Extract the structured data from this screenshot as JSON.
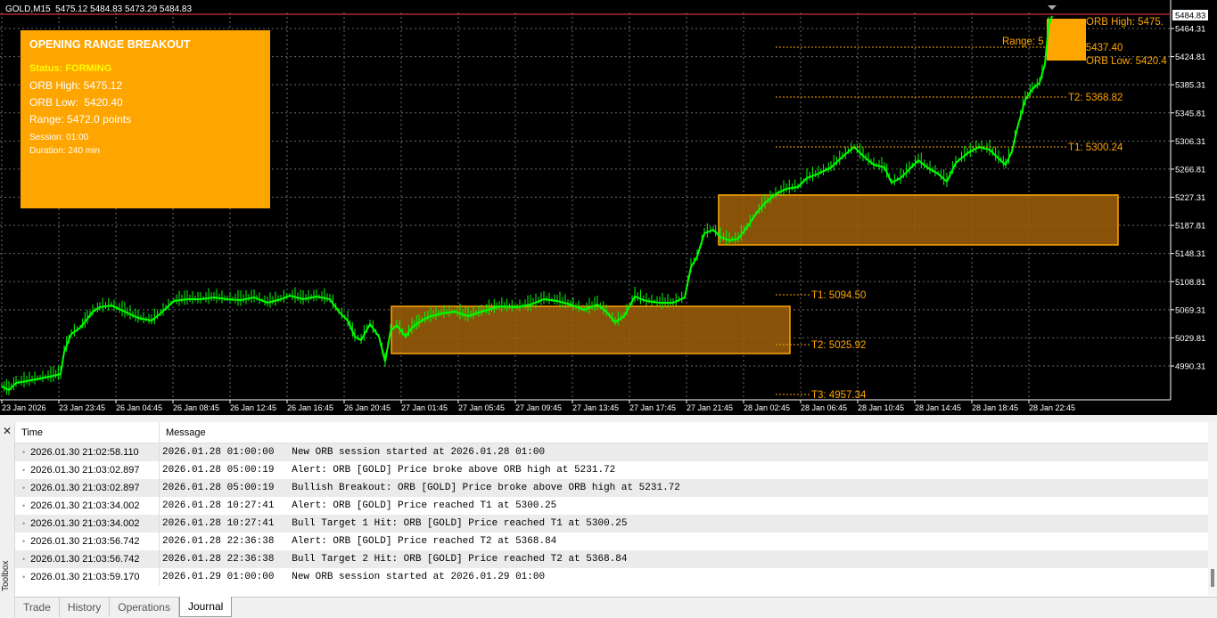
{
  "chart": {
    "symbol_line": "GOLD,M15  5475.12 5484.83 5473.29 5484.83",
    "current_price": "5484.83",
    "price_axis": [
      "5464.31",
      "5424.81",
      "5385.31",
      "5345.81",
      "5306.31",
      "5266.81",
      "5227.31",
      "5187.81",
      "5148.31",
      "5108.81",
      "5069.31",
      "5029.81",
      "4990.31"
    ],
    "time_axis": [
      "23 Jan 2026",
      "23 Jan 23:45",
      "26 Jan 04:45",
      "26 Jan 08:45",
      "26 Jan 12:45",
      "26 Jan 16:45",
      "26 Jan 20:45",
      "27 Jan 01:45",
      "27 Jan 05:45",
      "27 Jan 09:45",
      "27 Jan 13:45",
      "27 Jan 17:45",
      "27 Jan 21:45",
      "28 Jan 02:45",
      "28 Jan 06:45",
      "28 Jan 10:45",
      "28 Jan 14:45",
      "28 Jan 18:45",
      "28 Jan 22:45"
    ],
    "labels": {
      "orb_high": "ORB High: 5475.",
      "orb_low": "ORB Low: 5420.4",
      "range": "Range: 5",
      "t3_upper": "T3: 5437.40",
      "t2_upper": "T2: 5368.82",
      "t1_upper": "T1: 5300.24",
      "t1_lower": "T1: 5094.50",
      "t2_lower": "T2: 5025.92",
      "t3_lower": "T3: 4957.34"
    },
    "colors": {
      "candle": "#00ff00",
      "box": "#ffa500",
      "label": "#ffa500",
      "background": "#000000"
    }
  },
  "panel": {
    "title": "OPENING RANGE BREAKOUT",
    "status": "Status: FORMING",
    "orb_high": "ORB High: 5475.12",
    "orb_low": "ORB Low:  5420.40",
    "range": "Range: 5472.0 points",
    "session": "Session: 01:00",
    "duration": "Duration: 240 min"
  },
  "journal": {
    "headers": {
      "time": "Time",
      "message": "Message"
    },
    "rows": [
      {
        "time": "2026.01.30 21:02:58.110",
        "message": "2026.01.28 01:00:00   New ORB session started at 2026.01.28 01:00"
      },
      {
        "time": "2026.01.30 21:03:02.897",
        "message": "2026.01.28 05:00:19   Alert: ORB [GOLD] Price broke above ORB high at 5231.72"
      },
      {
        "time": "2026.01.30 21:03:02.897",
        "message": "2026.01.28 05:00:19   Bullish Breakout: ORB [GOLD] Price broke above ORB high at 5231.72"
      },
      {
        "time": "2026.01.30 21:03:34.002",
        "message": "2026.01.28 10:27:41   Alert: ORB [GOLD] Price reached T1 at 5300.25"
      },
      {
        "time": "2026.01.30 21:03:34.002",
        "message": "2026.01.28 10:27:41   Bull Target 1 Hit: ORB [GOLD] Price reached T1 at 5300.25"
      },
      {
        "time": "2026.01.30 21:03:56.742",
        "message": "2026.01.28 22:36:38   Alert: ORB [GOLD] Price reached T2 at 5368.84"
      },
      {
        "time": "2026.01.30 21:03:56.742",
        "message": "2026.01.28 22:36:38   Bull Target 2 Hit: ORB [GOLD] Price reached T2 at 5368.84"
      },
      {
        "time": "2026.01.30 21:03:59.170",
        "message": "2026.01.29 01:00:00   New ORB session started at 2026.01.29 01:00"
      }
    ],
    "tabs": [
      "Trade",
      "History",
      "Operations",
      "Journal"
    ],
    "active_tab": "Journal",
    "toolbox_label": "Toolbox",
    "close_icon": "close-icon"
  }
}
